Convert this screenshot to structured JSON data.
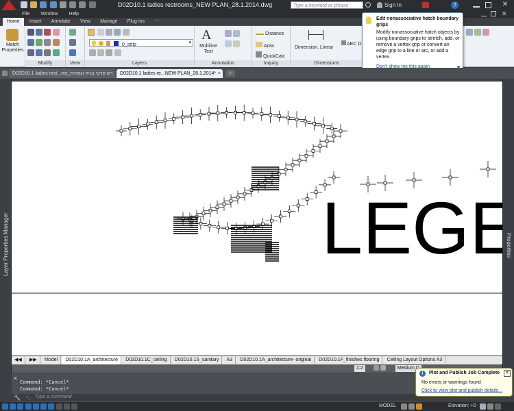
{
  "title_bar": {
    "file_name": "D02D10.1 ladies restrooms_NEW PLAN_28.1.2014.dwg",
    "search_placeholder": "Type a keyword or phrase",
    "sign_in": "Sign In"
  },
  "menu": [
    "File",
    "Window",
    "Help"
  ],
  "ribbon_tabs": [
    "Home",
    "Insert",
    "Annotate",
    "View",
    "Manage",
    "Plug-ins"
  ],
  "ribbon_active_tab": "Home",
  "ribbon": {
    "match_properties": "Match Properties",
    "match_line1": "Match",
    "match_line2": "Properties",
    "modify_label": "Modify",
    "view_label": "View",
    "layers_label": "Layers",
    "layer_name": "0_strip",
    "multiline_text_line1": "Multiline",
    "multiline_text_line2": "Text",
    "annotation_label": "Annotation",
    "distance": "Distance",
    "area": "Area",
    "quickcalc": "QuickCalc",
    "inquiry_label": "Inquiry",
    "dimension_linear": "Dimension, Linear",
    "aec_label": "AEC D",
    "dimensions_label": "Dimensions"
  },
  "tooltip": {
    "title": "Edit nonassociative hatch boundary grips",
    "body": "Modify nonassociative hatch objects by using boundary grips to stretch, add, or remove a vertex grip or convert an edge grip to a line or arc, or add a vertex.",
    "link": "Don't show me this again"
  },
  "doc_tabs": [
    {
      "label": "D02D10.1 ladies rest...ms_רש פרטי בניה וגמרות",
      "active": false
    },
    {
      "label": "D02D10.1 ladies re...NEW PLAN_28.1.2014*",
      "active": true
    }
  ],
  "drawing": {
    "legend_text": "LEGE"
  },
  "side_palettes": {
    "left": "Layer Properties Manager",
    "right": "Properties"
  },
  "layout_tabs": [
    "Model",
    "D02D10.1A_architecture",
    "D02D10.1C_ceiling",
    "D02D10.1S_sanitary",
    "A3",
    "D02D10.1A_architecture- original",
    "D02D10.1F_finishes flooring",
    "Ceiling Layout Options A3"
  ],
  "mid_bar": {
    "scale": "1:2",
    "style": "Medium D"
  },
  "command_history": [
    "Command: *Cancel*",
    "Command: *Cancel*"
  ],
  "command_placeholder": "Type a command",
  "notification": {
    "title": "Plot and Publish Job Complete",
    "line1": "No errors or warnings found",
    "link": "Click to view plot and publish details..."
  },
  "status": {
    "model": "MODEL",
    "elevation": "Elevation: +0"
  },
  "colors": {
    "accent": "#2a6fb8",
    "autocad_red": "#c0262c",
    "ui_dark": "#2b2d31",
    "ribbon_bg": "#eef1f5"
  }
}
